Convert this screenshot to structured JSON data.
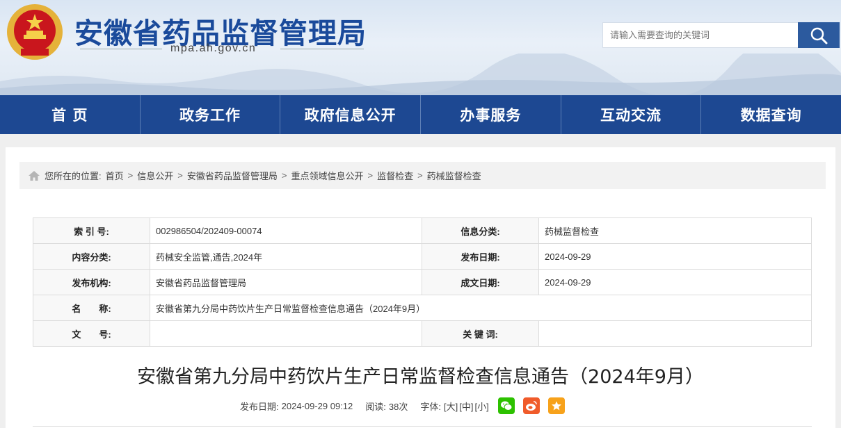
{
  "site": {
    "title": "安徽省药品监督管理局",
    "domain": "mpa.ah.gov.cn"
  },
  "search": {
    "placeholder": "请输入需要查询的关键词"
  },
  "nav": [
    "首 页",
    "政务工作",
    "政府信息公开",
    "办事服务",
    "互动交流",
    "数据查询"
  ],
  "breadcrumb": {
    "prefix": "您所在的位置:",
    "items": [
      "首页",
      "信息公开",
      "安徽省药品监督管理局",
      "重点领域信息公开",
      "监督检查",
      "药械监督检查"
    ],
    "separator": ">"
  },
  "meta": {
    "index_label": "索 引 号:",
    "index_value": "002986504/202409-00074",
    "info_cat_label": "信息分类:",
    "info_cat_value": "药械监督检查",
    "content_cat_label": "内容分类:",
    "content_cat_value": "药械安全监管,通告,2024年",
    "pub_date_label": "发布日期:",
    "pub_date_value": "2024-09-29",
    "org_label": "发布机构:",
    "org_value": "安徽省药品监督管理局",
    "doc_date_label": "成文日期:",
    "doc_date_value": "2024-09-29",
    "name_label": "名　　称:",
    "name_value": "安徽省第九分局中药饮片生产日常监督检查信息通告（2024年9月）",
    "docno_label": "文　　号:",
    "docno_value": "",
    "keywords_label": "关 键 词:",
    "keywords_value": ""
  },
  "article": {
    "title": "安徽省第九分局中药饮片生产日常监督检查信息通告（2024年9月）",
    "pub_label": "发布日期:",
    "pub_value": "2024-09-29 09:12",
    "read_label": "阅读:",
    "read_value": "38次",
    "font_label": "字体:",
    "font_large": "[大]",
    "font_medium": "[中]",
    "font_small": "[小]"
  },
  "colors": {
    "nav_bg": "#1d4892",
    "title_blue": "#1a4a9b",
    "wechat": "#2dc100",
    "weibo": "#f05b2a",
    "favorite": "#f7a21b"
  },
  "icons": [
    "national-emblem",
    "search-icon",
    "home-icon",
    "wechat-icon",
    "weibo-icon",
    "star-icon"
  ]
}
